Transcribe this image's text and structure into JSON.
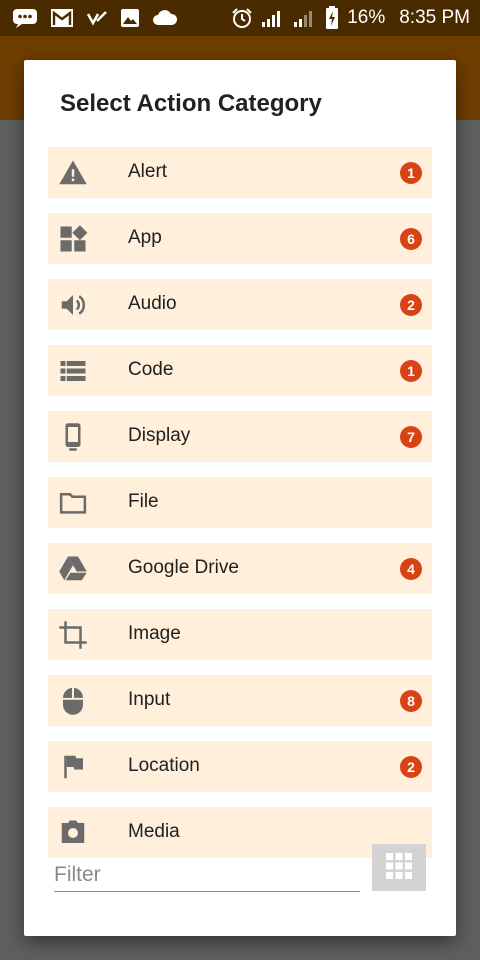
{
  "status_bar": {
    "left_icons": [
      "chat-icon",
      "gmail-icon",
      "check-icon",
      "image-icon",
      "cloud-icon"
    ],
    "right_icons": [
      "alarm-icon",
      "signal-icon",
      "signal-icon",
      "battery-charging-icon"
    ],
    "battery": "16%",
    "time": "8:35 PM"
  },
  "dialog": {
    "title": "Select Action Category",
    "items": [
      {
        "label": "Alert",
        "icon": "warning-icon",
        "badge": "1"
      },
      {
        "label": "App",
        "icon": "apps-icon",
        "badge": "6"
      },
      {
        "label": "Audio",
        "icon": "volume-icon",
        "badge": "2"
      },
      {
        "label": "Code",
        "icon": "list-icon",
        "badge": "1"
      },
      {
        "label": "Display",
        "icon": "phone-icon",
        "badge": "7"
      },
      {
        "label": "File",
        "icon": "folder-icon",
        "badge": ""
      },
      {
        "label": "Google Drive",
        "icon": "google-drive-icon",
        "badge": "4"
      },
      {
        "label": "Image",
        "icon": "crop-icon",
        "badge": ""
      },
      {
        "label": "Input",
        "icon": "mouse-icon",
        "badge": "8"
      },
      {
        "label": "Location",
        "icon": "flag-icon",
        "badge": "2"
      },
      {
        "label": "Media",
        "icon": "camera-icon",
        "badge": ""
      }
    ],
    "filter": {
      "placeholder": "Filter",
      "value": ""
    },
    "grid_button_icon": "grid-icon"
  },
  "colors": {
    "status_bar": "#4a2b00",
    "app_bar": "#6e3d00",
    "scrim": "#5f5f5f",
    "item_background": "#ffefdb",
    "badge": "#d84315",
    "icon": "#6b6b6b"
  }
}
